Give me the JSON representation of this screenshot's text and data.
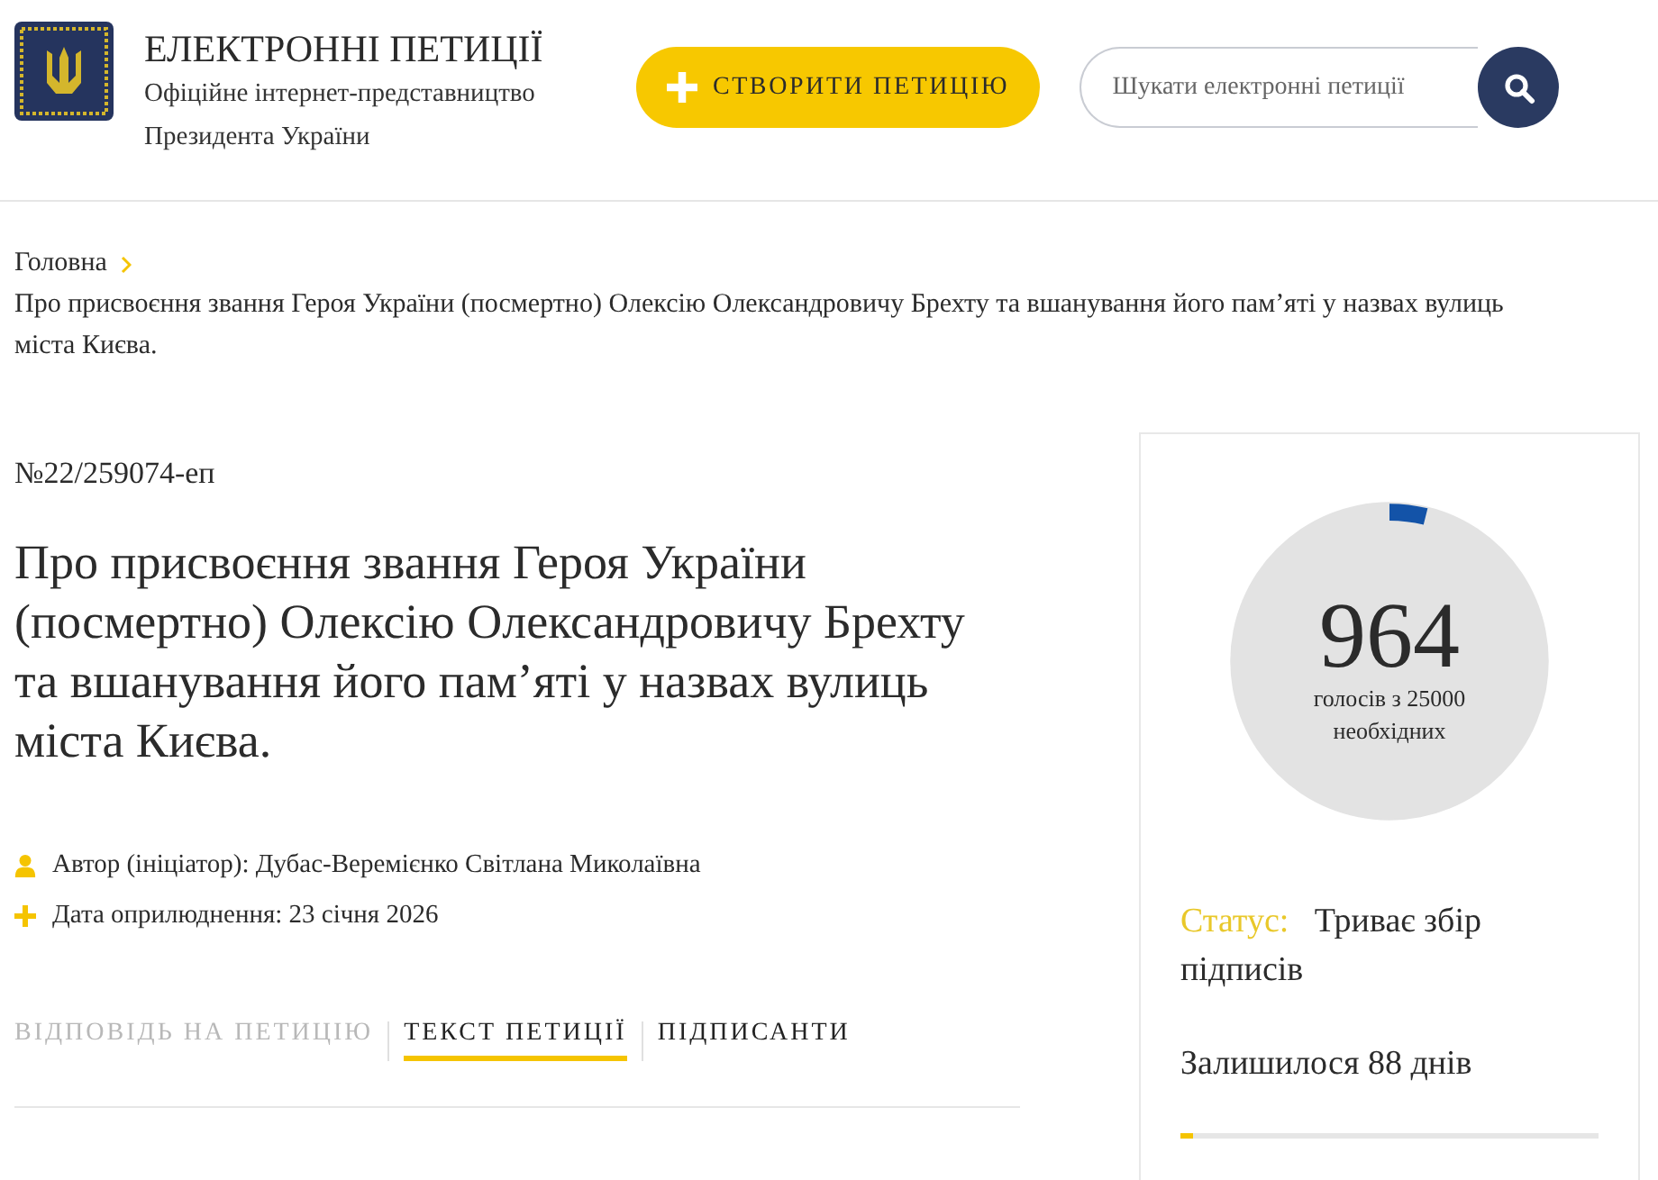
{
  "header": {
    "title": "ЕЛЕКТРОННІ ПЕТИЦІЇ",
    "subtitle_lines": [
      "Офіційне інтернет-представництво",
      "Президента України"
    ],
    "create_button": "СТВОРИТИ ПЕТИЦІЮ",
    "search": {
      "placeholder": "Шукати електронні петиції"
    }
  },
  "breadcrumb": {
    "home": "Головна",
    "current": "Про присвоєння звання Героя України (посмертно) Олексію Олександровичу Брехту та вшанування його пам’яті у назвах вулиць міста Києва."
  },
  "petition": {
    "number": "№22/259074-еп",
    "title": "Про присвоєння звання Героя України (посмертно) Олексію Олександровичу Брехту та вшанування його пам’яті у назвах вулиць міста Києва.",
    "meta": [
      {
        "kind": "author",
        "text": "Автор (ініціатор): Дубас-Веремієнко Світлана Миколаївна"
      },
      {
        "kind": "date",
        "text": "Дата оприлюднення: 23 січня 2026"
      }
    ]
  },
  "tabs": [
    {
      "label": "ВІДПОВІДЬ НА ПЕТИЦІЮ",
      "selected": false,
      "disabled": true
    },
    {
      "label": "ТЕКСТ ПЕТИЦІЇ",
      "selected": true,
      "disabled": false
    },
    {
      "label": "ПІДПИСАНТИ",
      "selected": false,
      "disabled": false
    }
  ],
  "votes": {
    "count": "964",
    "caption_lines": [
      "голосів з 25000",
      "необхідних"
    ],
    "level": 0.039,
    "status_label": "Статус:",
    "status_value": "Триває збір підписів",
    "days_left": "Залишилося 88 днів",
    "days_bar": {
      "level": 0.03
    }
  }
}
